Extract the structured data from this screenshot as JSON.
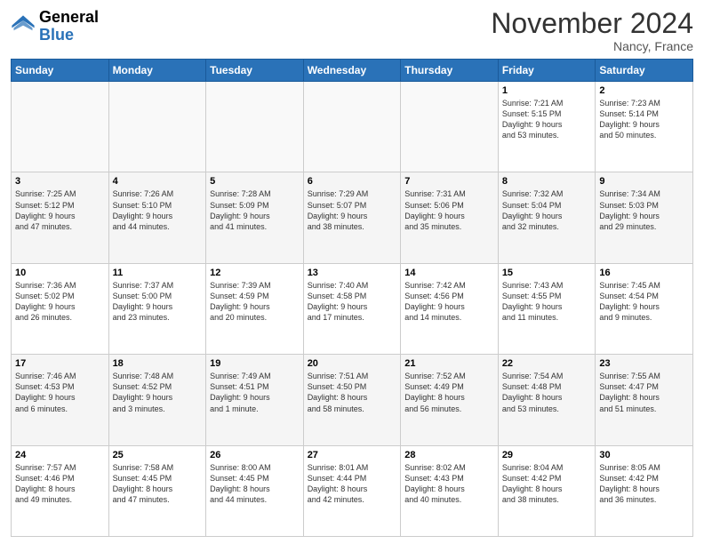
{
  "header": {
    "logo_general": "General",
    "logo_blue": "Blue",
    "title": "November 2024",
    "location": "Nancy, France"
  },
  "days_of_week": [
    "Sunday",
    "Monday",
    "Tuesday",
    "Wednesday",
    "Thursday",
    "Friday",
    "Saturday"
  ],
  "weeks": [
    [
      {
        "day": "",
        "info": ""
      },
      {
        "day": "",
        "info": ""
      },
      {
        "day": "",
        "info": ""
      },
      {
        "day": "",
        "info": ""
      },
      {
        "day": "",
        "info": ""
      },
      {
        "day": "1",
        "info": "Sunrise: 7:21 AM\nSunset: 5:15 PM\nDaylight: 9 hours\nand 53 minutes."
      },
      {
        "day": "2",
        "info": "Sunrise: 7:23 AM\nSunset: 5:14 PM\nDaylight: 9 hours\nand 50 minutes."
      }
    ],
    [
      {
        "day": "3",
        "info": "Sunrise: 7:25 AM\nSunset: 5:12 PM\nDaylight: 9 hours\nand 47 minutes."
      },
      {
        "day": "4",
        "info": "Sunrise: 7:26 AM\nSunset: 5:10 PM\nDaylight: 9 hours\nand 44 minutes."
      },
      {
        "day": "5",
        "info": "Sunrise: 7:28 AM\nSunset: 5:09 PM\nDaylight: 9 hours\nand 41 minutes."
      },
      {
        "day": "6",
        "info": "Sunrise: 7:29 AM\nSunset: 5:07 PM\nDaylight: 9 hours\nand 38 minutes."
      },
      {
        "day": "7",
        "info": "Sunrise: 7:31 AM\nSunset: 5:06 PM\nDaylight: 9 hours\nand 35 minutes."
      },
      {
        "day": "8",
        "info": "Sunrise: 7:32 AM\nSunset: 5:04 PM\nDaylight: 9 hours\nand 32 minutes."
      },
      {
        "day": "9",
        "info": "Sunrise: 7:34 AM\nSunset: 5:03 PM\nDaylight: 9 hours\nand 29 minutes."
      }
    ],
    [
      {
        "day": "10",
        "info": "Sunrise: 7:36 AM\nSunset: 5:02 PM\nDaylight: 9 hours\nand 26 minutes."
      },
      {
        "day": "11",
        "info": "Sunrise: 7:37 AM\nSunset: 5:00 PM\nDaylight: 9 hours\nand 23 minutes."
      },
      {
        "day": "12",
        "info": "Sunrise: 7:39 AM\nSunset: 4:59 PM\nDaylight: 9 hours\nand 20 minutes."
      },
      {
        "day": "13",
        "info": "Sunrise: 7:40 AM\nSunset: 4:58 PM\nDaylight: 9 hours\nand 17 minutes."
      },
      {
        "day": "14",
        "info": "Sunrise: 7:42 AM\nSunset: 4:56 PM\nDaylight: 9 hours\nand 14 minutes."
      },
      {
        "day": "15",
        "info": "Sunrise: 7:43 AM\nSunset: 4:55 PM\nDaylight: 9 hours\nand 11 minutes."
      },
      {
        "day": "16",
        "info": "Sunrise: 7:45 AM\nSunset: 4:54 PM\nDaylight: 9 hours\nand 9 minutes."
      }
    ],
    [
      {
        "day": "17",
        "info": "Sunrise: 7:46 AM\nSunset: 4:53 PM\nDaylight: 9 hours\nand 6 minutes."
      },
      {
        "day": "18",
        "info": "Sunrise: 7:48 AM\nSunset: 4:52 PM\nDaylight: 9 hours\nand 3 minutes."
      },
      {
        "day": "19",
        "info": "Sunrise: 7:49 AM\nSunset: 4:51 PM\nDaylight: 9 hours\nand 1 minute."
      },
      {
        "day": "20",
        "info": "Sunrise: 7:51 AM\nSunset: 4:50 PM\nDaylight: 8 hours\nand 58 minutes."
      },
      {
        "day": "21",
        "info": "Sunrise: 7:52 AM\nSunset: 4:49 PM\nDaylight: 8 hours\nand 56 minutes."
      },
      {
        "day": "22",
        "info": "Sunrise: 7:54 AM\nSunset: 4:48 PM\nDaylight: 8 hours\nand 53 minutes."
      },
      {
        "day": "23",
        "info": "Sunrise: 7:55 AM\nSunset: 4:47 PM\nDaylight: 8 hours\nand 51 minutes."
      }
    ],
    [
      {
        "day": "24",
        "info": "Sunrise: 7:57 AM\nSunset: 4:46 PM\nDaylight: 8 hours\nand 49 minutes."
      },
      {
        "day": "25",
        "info": "Sunrise: 7:58 AM\nSunset: 4:45 PM\nDaylight: 8 hours\nand 47 minutes."
      },
      {
        "day": "26",
        "info": "Sunrise: 8:00 AM\nSunset: 4:45 PM\nDaylight: 8 hours\nand 44 minutes."
      },
      {
        "day": "27",
        "info": "Sunrise: 8:01 AM\nSunset: 4:44 PM\nDaylight: 8 hours\nand 42 minutes."
      },
      {
        "day": "28",
        "info": "Sunrise: 8:02 AM\nSunset: 4:43 PM\nDaylight: 8 hours\nand 40 minutes."
      },
      {
        "day": "29",
        "info": "Sunrise: 8:04 AM\nSunset: 4:42 PM\nDaylight: 8 hours\nand 38 minutes."
      },
      {
        "day": "30",
        "info": "Sunrise: 8:05 AM\nSunset: 4:42 PM\nDaylight: 8 hours\nand 36 minutes."
      }
    ]
  ]
}
